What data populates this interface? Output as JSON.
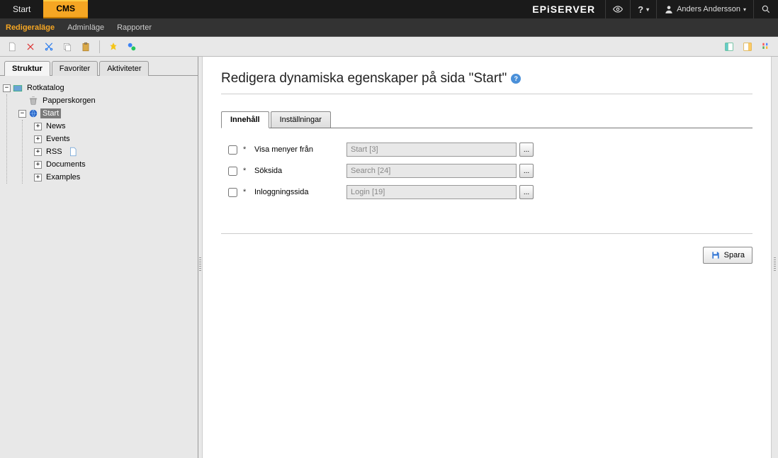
{
  "topbar": {
    "tabs": [
      {
        "label": "Start",
        "active": false
      },
      {
        "label": "CMS",
        "active": true
      }
    ],
    "brand": "EPiSERVER",
    "user": "Anders Andersson"
  },
  "menubar": {
    "items": [
      {
        "label": "Redigeraläge",
        "active": true
      },
      {
        "label": "Adminläge",
        "active": false
      },
      {
        "label": "Rapporter",
        "active": false
      }
    ]
  },
  "sidebar": {
    "tabs": [
      {
        "label": "Struktur",
        "active": true
      },
      {
        "label": "Favoriter",
        "active": false
      },
      {
        "label": "Aktiviteter",
        "active": false
      }
    ],
    "root": "Rotkatalog",
    "trash": "Papperskorgen",
    "selected": "Start",
    "children": [
      {
        "label": "News"
      },
      {
        "label": "Events"
      },
      {
        "label": "RSS"
      },
      {
        "label": "Documents"
      },
      {
        "label": "Examples"
      }
    ]
  },
  "content": {
    "title": "Redigera dynamiska egenskaper på sida \"Start\"",
    "tabs": [
      {
        "label": "Innehåll",
        "active": true
      },
      {
        "label": "Inställningar",
        "active": false
      }
    ],
    "rows": [
      {
        "label": "Visa menyer från",
        "value": "Start [3]"
      },
      {
        "label": "Söksida",
        "value": "Search [24]"
      },
      {
        "label": "Inloggningssida",
        "value": "Login [19]"
      }
    ],
    "save_label": "Spara"
  },
  "glyphs": {
    "star": "*",
    "ellipsis": "...",
    "help": "?",
    "plus": "+",
    "minus": "−"
  }
}
